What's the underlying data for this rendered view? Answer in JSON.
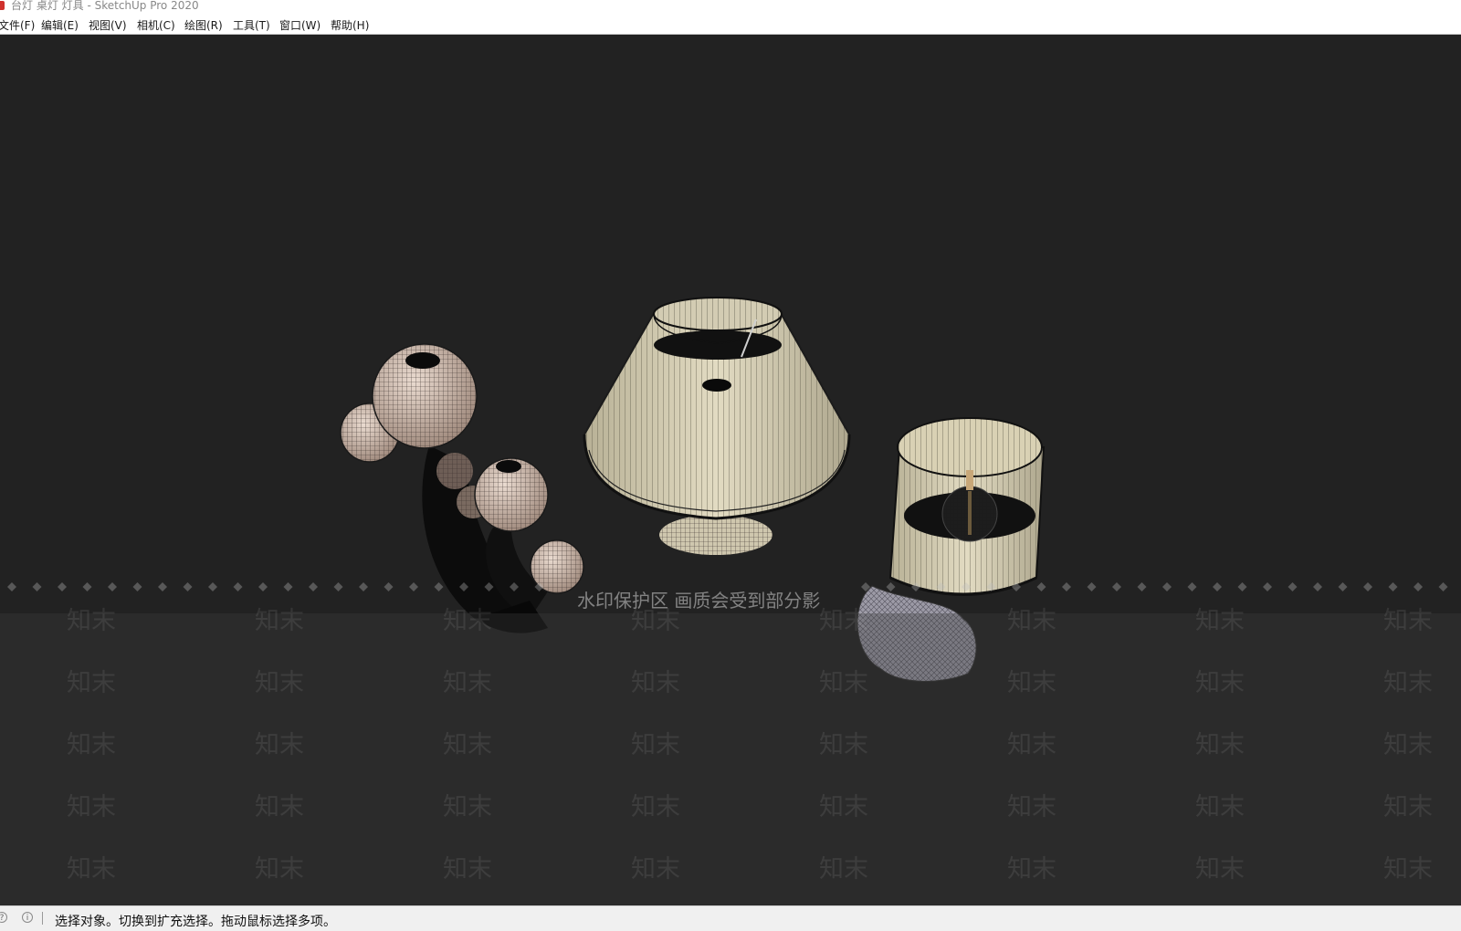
{
  "window": {
    "title": "台灯 桌灯 灯具 - SketchUp Pro 2020"
  },
  "menu": [
    {
      "label": "文件(F)"
    },
    {
      "label": "编辑(E)"
    },
    {
      "label": "视图(V)"
    },
    {
      "label": "相机(C)"
    },
    {
      "label": "绘图(R)"
    },
    {
      "label": "工具(T)"
    },
    {
      "label": "窗口(W)"
    },
    {
      "label": "帮助(H)"
    }
  ],
  "watermark": {
    "notice": "水印保护区  画质会受到部分影",
    "brand": "知末"
  },
  "status": {
    "message": "选择对象。切换到扩充选择。拖动鼠标选择多项。"
  },
  "colors": {
    "viewport": "#222222",
    "lampshade": "#d9d1b4",
    "globe": "#cdb4a4",
    "stone_base": "#9c9aa6"
  }
}
